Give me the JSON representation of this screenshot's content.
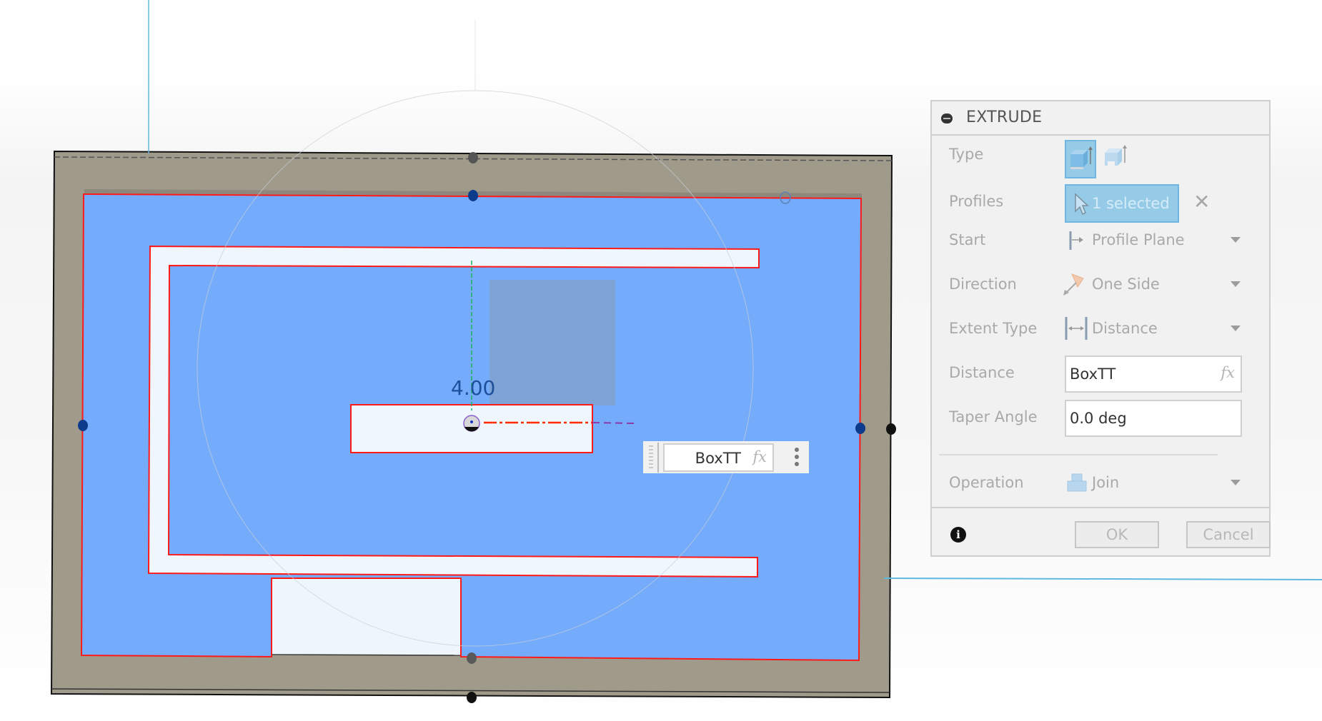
{
  "viewport": {
    "dimension_label": "4.00",
    "inline_input": {
      "value": "BoxTT",
      "fx_label": "fx"
    },
    "colors": {
      "frame": "#a09a8b",
      "profile_fill": "#75abfb",
      "profile_outline": "#ff1a1a",
      "cutout": "#eff6fd",
      "axis_line": "#5fb8e0",
      "dimension_text": "#1d4f9a"
    }
  },
  "dialog": {
    "title": "EXTRUDE",
    "rows": {
      "type": {
        "label": "Type",
        "options": [
          "solid-extrude-icon",
          "thin-extrude-icon"
        ],
        "selected": 0
      },
      "profiles": {
        "label": "Profiles",
        "value": "1 selected",
        "clear_label": "✕"
      },
      "start": {
        "label": "Start",
        "value": "Profile Plane"
      },
      "direction": {
        "label": "Direction",
        "value": "One Side"
      },
      "extent_type": {
        "label": "Extent Type",
        "value": "Distance"
      },
      "distance": {
        "label": "Distance",
        "value": "BoxTT",
        "fx_label": "fx"
      },
      "taper_angle": {
        "label": "Taper Angle",
        "value": "0.0 deg"
      },
      "operation": {
        "label": "Operation",
        "value": "Join"
      }
    },
    "footer": {
      "info_label": "i",
      "ok_label": "OK",
      "cancel_label": "Cancel"
    }
  }
}
